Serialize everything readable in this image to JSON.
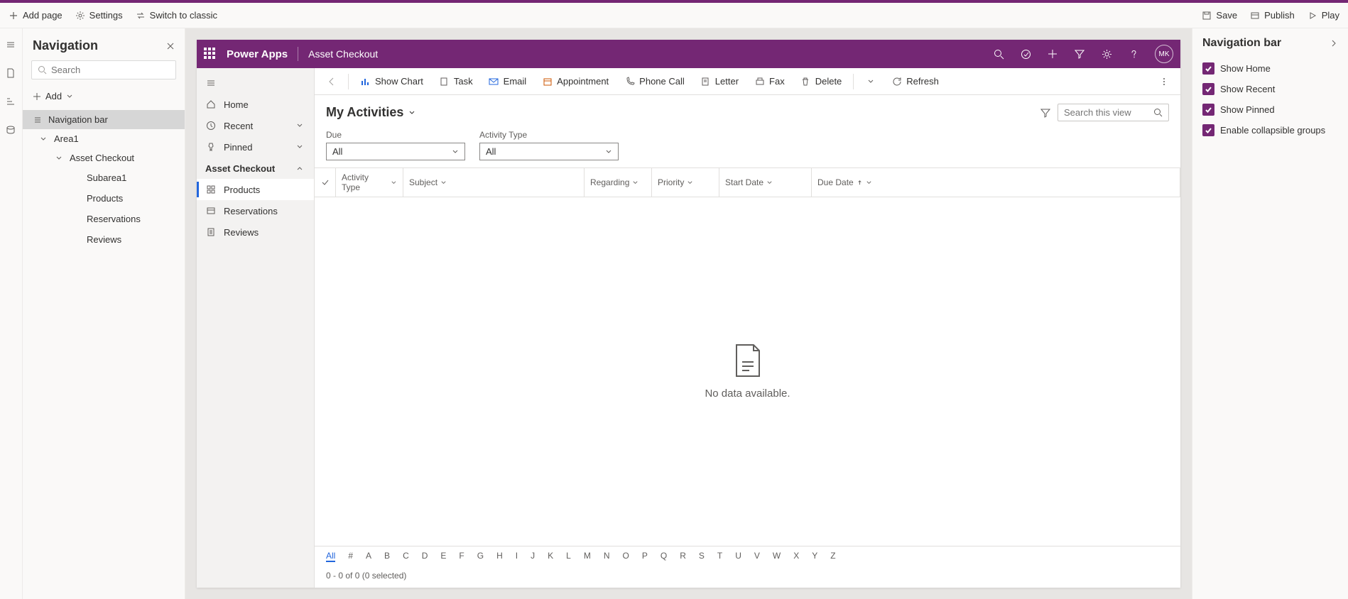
{
  "topbar": {
    "add_page": "Add page",
    "settings": "Settings",
    "switch": "Switch to classic",
    "save": "Save",
    "publish": "Publish",
    "play": "Play"
  },
  "navPanel": {
    "title": "Navigation",
    "searchPlaceholder": "Search",
    "add": "Add",
    "items": {
      "navbar": "Navigation bar",
      "area1": "Area1",
      "assetCheckout": "Asset Checkout",
      "subarea1": "Subarea1",
      "products": "Products",
      "reservations": "Reservations",
      "reviews": "Reviews"
    }
  },
  "app": {
    "brand": "Power Apps",
    "name": "Asset Checkout",
    "avatar": "MK",
    "side": {
      "home": "Home",
      "recent": "Recent",
      "pinned": "Pinned",
      "group": "Asset Checkout",
      "products": "Products",
      "reservations": "Reservations",
      "reviews": "Reviews"
    },
    "cmd": {
      "showChart": "Show Chart",
      "task": "Task",
      "email": "Email",
      "appointment": "Appointment",
      "phone": "Phone Call",
      "letter": "Letter",
      "fax": "Fax",
      "delete": "Delete",
      "refresh": "Refresh"
    },
    "viewTitle": "My Activities",
    "searchPlaceholder": "Search this view",
    "filters": {
      "dueLabel": "Due",
      "dueValue": "All",
      "typeLabel": "Activity Type",
      "typeValue": "All"
    },
    "cols": {
      "activityType": "Activity Type",
      "subject": "Subject",
      "regarding": "Regarding",
      "priority": "Priority",
      "startDate": "Start Date",
      "dueDate": "Due Date"
    },
    "empty": "No data available.",
    "alpha": [
      "All",
      "#",
      "A",
      "B",
      "C",
      "D",
      "E",
      "F",
      "G",
      "H",
      "I",
      "J",
      "K",
      "L",
      "M",
      "N",
      "O",
      "P",
      "Q",
      "R",
      "S",
      "T",
      "U",
      "V",
      "W",
      "X",
      "Y",
      "Z"
    ],
    "status": "0 - 0 of 0 (0 selected)"
  },
  "propPanel": {
    "title": "Navigation bar",
    "opts": {
      "home": "Show Home",
      "recent": "Show Recent",
      "pinned": "Show Pinned",
      "collapsible": "Enable collapsible groups"
    }
  }
}
